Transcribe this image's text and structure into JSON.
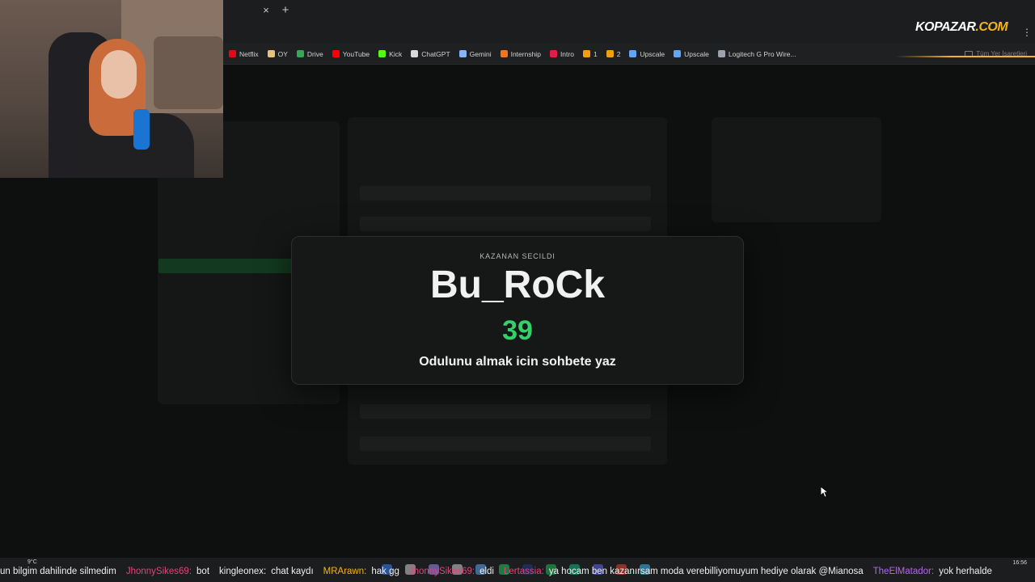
{
  "browser": {
    "bookmarks": [
      {
        "label": "Netflix",
        "icon": "netflix-icon",
        "color": "#e50914"
      },
      {
        "label": "OY",
        "icon": "oy-icon",
        "color": "#e7c27a"
      },
      {
        "label": "Drive",
        "icon": "drive-icon",
        "color": "#34a853"
      },
      {
        "label": "YouTube",
        "icon": "youtube-icon",
        "color": "#ff0000"
      },
      {
        "label": "Kick",
        "icon": "kick-icon",
        "color": "#53fc18"
      },
      {
        "label": "ChatGPT",
        "icon": "chatgpt-icon",
        "color": "#d9d9d9"
      },
      {
        "label": "Gemini",
        "icon": "gemini-icon",
        "color": "#8ab4f8"
      },
      {
        "label": "Internship",
        "icon": "internship-icon",
        "color": "#f97316"
      },
      {
        "label": "Intro",
        "icon": "intro-icon",
        "color": "#e11d48"
      },
      {
        "label": "1",
        "icon": "infinity-icon",
        "color": "#f59e0b"
      },
      {
        "label": "2",
        "icon": "infinity-icon",
        "color": "#f59e0b"
      },
      {
        "label": "Upscale",
        "icon": "upscale-icon",
        "color": "#60a5fa"
      },
      {
        "label": "Upscale",
        "icon": "upscale-icon",
        "color": "#60a5fa"
      },
      {
        "label": "Logitech G Pro Wire...",
        "icon": "logitech-icon",
        "color": "#9ca3af"
      }
    ],
    "all_bookmarks_label": "Tüm Yer İşaretleri",
    "tab_close": "×",
    "tab_new": "+"
  },
  "overlay": {
    "logo_main": "KOPAZAR",
    "logo_accent": ".COM"
  },
  "modal": {
    "heading": "KAZANAN SECILDI",
    "winner_name": "Bu_RoCk",
    "winner_number": "39",
    "instruction": "Odulunu almak icin sohbete yaz"
  },
  "ticker": [
    {
      "user": "",
      "text": "un bilgim dahilinde silmedim",
      "color": "#f0f0f0"
    },
    {
      "user": "JhonnySikes69:",
      "text": "bot",
      "color": "#e0457b"
    },
    {
      "user": "kingleonex:",
      "text": "chat kaydı",
      "color": "#f0f0f0"
    },
    {
      "user": "MRArawn:",
      "text": "hak gg",
      "color": "#f2b51b"
    },
    {
      "user": "JhonnySikes69:",
      "text": "eldi",
      "color": "#e0457b"
    },
    {
      "user": "Lertassia:",
      "text": "ya hocam ben kazanırsam moda verebilliyomuyum hediye olarak @Mianosa",
      "color": "#e0457b"
    },
    {
      "user": "TheElMatador:",
      "text": "yok herhalde",
      "color": "#b06be6"
    }
  ],
  "taskbar": {
    "weather": "9°C",
    "time": "16:56"
  },
  "colors": {
    "accent_green": "#33d16a",
    "modal_bg": "#161717",
    "logo_accent": "#f2b51b"
  }
}
